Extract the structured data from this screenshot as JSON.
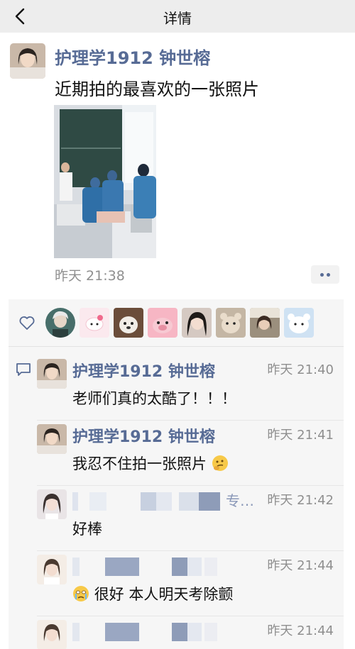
{
  "nav": {
    "title": "详情"
  },
  "post": {
    "author": "护理学1912 钟世榕",
    "text": "近期拍的最喜欢的一张照片",
    "time": "昨天 21:38"
  },
  "comments": [
    {
      "name": "护理学1912 钟世榕",
      "time": "昨天 21:40",
      "text": "老师们真的太酷了！！！"
    },
    {
      "name": "护理学1912 钟世榕",
      "time": "昨天 21:41",
      "text": "我忍不住拍一张照片",
      "emoji": "thinking-emoji-icon"
    },
    {
      "name_partial": "专…",
      "time": "昨天 21:42",
      "text": "好棒"
    },
    {
      "time": "昨天 21:44",
      "text": "很好 本人明天考除颤",
      "emoji": "crying-emoji-icon"
    },
    {
      "time": "昨天 21:44"
    }
  ],
  "colors": {
    "name": "#576b95",
    "time": "#8f8f8f",
    "navbar": "#ededed",
    "comment_bg": "#f6f6f6"
  }
}
